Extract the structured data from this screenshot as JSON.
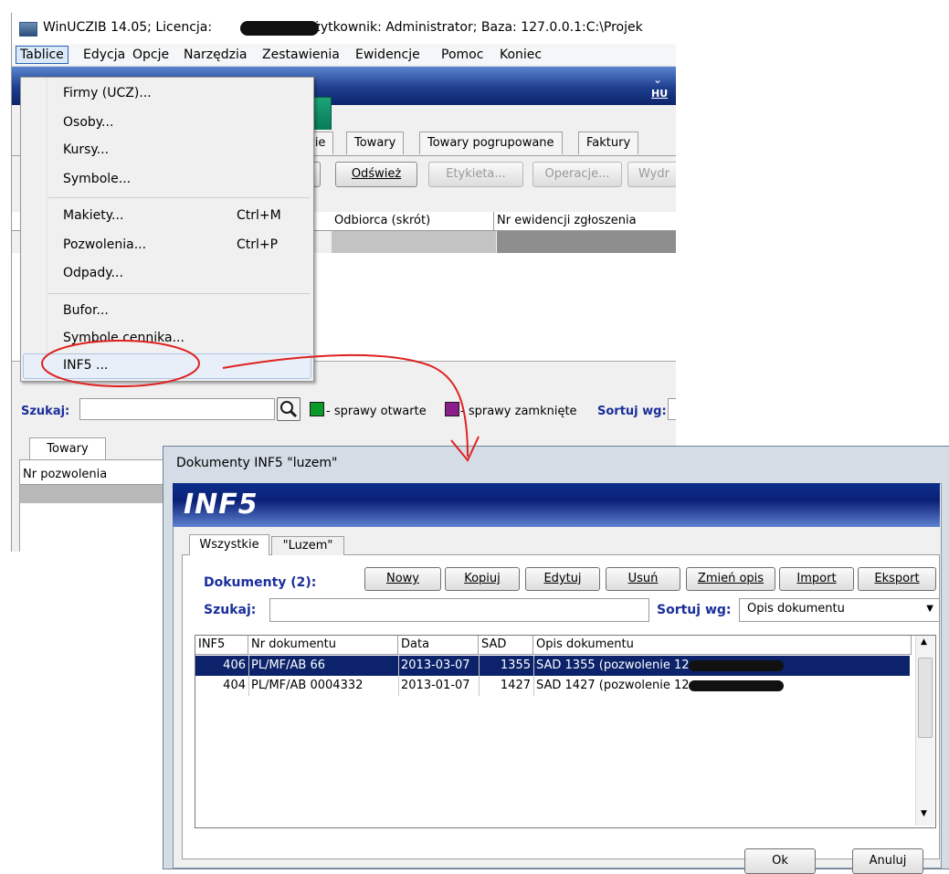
{
  "main_window": {
    "title": "WinUCZIB 14.05;  Licencja:",
    "title_rest": "; Użytkownik: Administrator;  Baza: 127.0.0.1:C:\\Projek",
    "menu": [
      "Tablice",
      "Edycja",
      "Opcje",
      "Narzędzia",
      "Zestawienia",
      "Ewidencje",
      "Pomoc",
      "Koniec"
    ],
    "logo_text": "HU",
    "tabs": [
      "zie",
      "Towary",
      "Towary pogrupowane",
      "Faktury"
    ],
    "toolbar": {
      "refresh_label": "Odśwież",
      "label_label": "Etykieta...",
      "operations_label": "Operacje...",
      "print_label": "Wydr"
    },
    "grid_headers": [
      "Odbiorca (skrót)",
      "Nr ewidencji zgłoszenia"
    ],
    "search_label": "Szukaj:",
    "legend_open": "- sprawy otwarte",
    "legend_closed": "- sprawy zamknięte",
    "sort_label": "Sortuj wg:",
    "lower_tab": "Towary",
    "lower_header": "Nr pozwolenia",
    "colors": {
      "open_case": "#0a9a2a",
      "closed_case": "#8a1f8a",
      "accent": "#1a2f9a"
    }
  },
  "dropdown_menu": {
    "items": [
      {
        "label": "Firmy (UCZ)...",
        "shortcut": ""
      },
      {
        "label": "Osoby...",
        "shortcut": ""
      },
      {
        "label": "Kursy...",
        "shortcut": ""
      },
      {
        "label": "Symbole...",
        "shortcut": ""
      },
      {
        "label": "Makiety...",
        "shortcut": "Ctrl+M"
      },
      {
        "label": "Pozwolenia...",
        "shortcut": "Ctrl+P"
      },
      {
        "label": "Odpady...",
        "shortcut": ""
      },
      {
        "label": "Bufor...",
        "shortcut": ""
      },
      {
        "label": "Symbole cennika...",
        "shortcut": ""
      },
      {
        "label": "INF5 ...",
        "shortcut": ""
      }
    ],
    "highlighted": "INF5 ..."
  },
  "dialog": {
    "title": "Dokumenty INF5 \"luzem\"",
    "banner": "INF5",
    "tabs": [
      "Wszystkie",
      "\"Luzem\""
    ],
    "documents_label": "Dokumenty (2):",
    "buttons": [
      "Nowy",
      "Kopiuj",
      "Edytuj",
      "Usuń",
      "Zmień opis",
      "Import",
      "Eksport"
    ],
    "search_label": "Szukaj:",
    "sort_label": "Sortuj wg:",
    "sort_value": "Opis dokumentu",
    "columns": [
      "INF5",
      "Nr dokumentu",
      "Data",
      "SAD",
      "Opis dokumentu"
    ],
    "rows": [
      {
        "inf5": "406",
        "nr": "PL/MF/AB  66",
        "data": "2013-03-07",
        "sad": "1355",
        "opis": "SAD 1355 (pozwolenie 12"
      },
      {
        "inf5": "404",
        "nr": "PL/MF/AB  0004332",
        "data": "2013-01-07",
        "sad": "1427",
        "opis": "SAD 1427 (pozwolenie 12"
      }
    ],
    "ok_label": "Ok",
    "cancel_label": "Anuluj"
  }
}
